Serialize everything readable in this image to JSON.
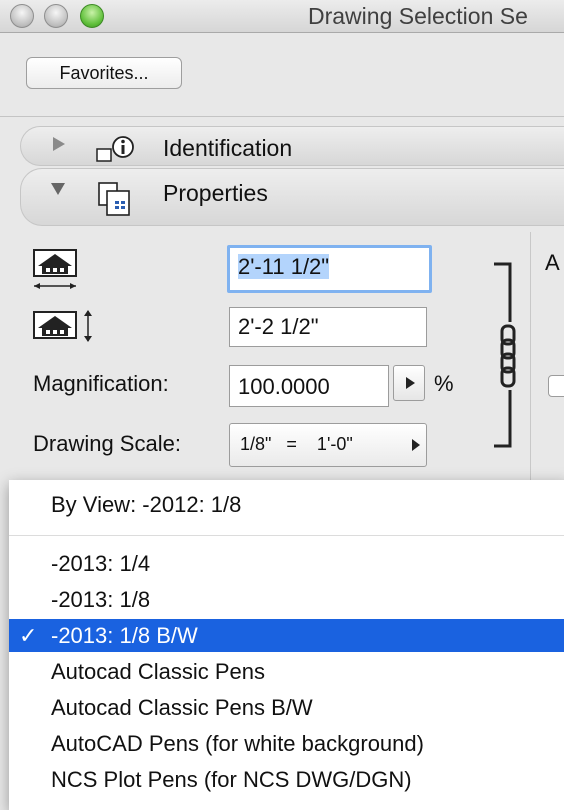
{
  "window": {
    "title": "Drawing Selection Se"
  },
  "toolbar": {
    "favorites_label": "Favorites..."
  },
  "panels": {
    "identification": {
      "label": "Identification"
    },
    "properties": {
      "label": "Properties"
    }
  },
  "properties": {
    "width_value": "2'-11 1/2\"",
    "height_value": "2'-2 1/2\"",
    "magnification_label": "Magnification:",
    "magnification_value": "100.0000",
    "percent_sign": "%",
    "drawing_scale_label": "Drawing Scale:",
    "drawing_scale_value": "1/8\"   =    1'-0\""
  },
  "right_column": {
    "partial_letter": "A"
  },
  "pen_menu": {
    "items": [
      {
        "label": "By View: -2012: 1/8",
        "selected": false
      },
      {
        "label": "-2013: 1/4",
        "selected": false
      },
      {
        "label": "-2013: 1/8",
        "selected": false
      },
      {
        "label": "-2013: 1/8 B/W",
        "selected": true
      },
      {
        "label": "Autocad Classic Pens",
        "selected": false
      },
      {
        "label": "Autocad Classic Pens B/W",
        "selected": false
      },
      {
        "label": "AutoCAD Pens (for white background)",
        "selected": false
      },
      {
        "label": "NCS Plot Pens (for NCS DWG/DGN)",
        "selected": false
      }
    ],
    "check_mark": "✓"
  },
  "colors": {
    "selection": "#1a62e0",
    "field_focus": "#7fb2f0"
  },
  "icons": [
    "disclosure-triangle-icon",
    "info-icon",
    "properties-icon",
    "width-icon",
    "height-icon",
    "link-chain-icon",
    "arrow-right-icon"
  ]
}
